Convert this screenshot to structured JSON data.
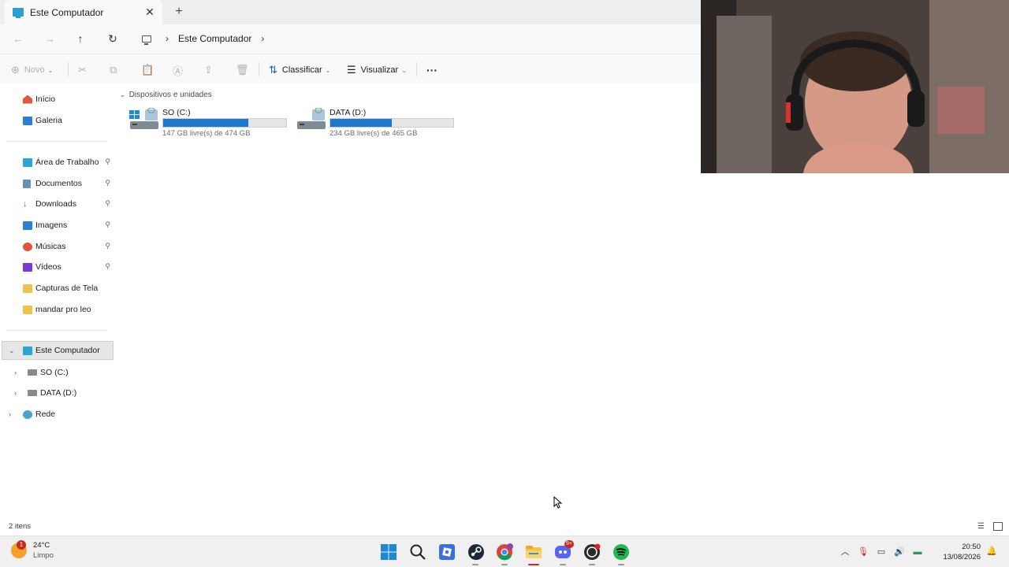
{
  "window": {
    "tab_title": "Este Computador",
    "tab_close": "✕",
    "new_tab": "+"
  },
  "nav": {
    "back": "←",
    "forward": "→",
    "up": "↑",
    "refresh": "↻",
    "breadcrumb": [
      "Este Computador"
    ],
    "sep": "›"
  },
  "toolbar": {
    "new_label": "Novo",
    "sort_label": "Classificar",
    "view_label": "Visualizar",
    "more": "···"
  },
  "sidebar": {
    "top_items": [
      {
        "label": "Início",
        "icon": "home-icon",
        "color": "#e05a3a"
      },
      {
        "label": "Galeria",
        "icon": "gallery-icon",
        "color": "#2a7fd6"
      }
    ],
    "pinned": [
      {
        "label": "Área de Trabalho",
        "icon": "desktop-icon",
        "color": "#2aa6d6"
      },
      {
        "label": "Documentos",
        "icon": "documents-icon",
        "color": "#6a8fb5"
      },
      {
        "label": "Downloads",
        "icon": "downloads-icon",
        "color": "#2e9a5e"
      },
      {
        "label": "Imagens",
        "icon": "pictures-icon",
        "color": "#2a7fd6"
      },
      {
        "label": "Músicas",
        "icon": "music-icon",
        "color": "#e0533a"
      },
      {
        "label": "Vídeos",
        "icon": "videos-icon",
        "color": "#7a3ad6"
      },
      {
        "label": "Capturas de Tela",
        "icon": "folder-icon",
        "color": "#f0c14b"
      },
      {
        "label": "mandar pro leo",
        "icon": "folder-icon",
        "color": "#f0c14b"
      }
    ],
    "pin_glyph": "📌",
    "tree": [
      {
        "label": "Este Computador",
        "icon": "this-pc-icon",
        "selected": true
      },
      {
        "label": "SO (C:)",
        "icon": "drive-c-icon"
      },
      {
        "label": "DATA (D:)",
        "icon": "drive-d-icon"
      },
      {
        "label": "Rede",
        "icon": "network-icon"
      }
    ]
  },
  "main": {
    "group_header": "Dispositivos e unidades",
    "drives": [
      {
        "label": "SO (C:)",
        "free": "147 GB livre(s) de 474 GB",
        "used_fraction": 0.69
      },
      {
        "label": "DATA (D:)",
        "free": "234 GB livre(s) de 465 GB",
        "used_fraction": 0.5
      }
    ]
  },
  "status": {
    "item_count": "2 itens"
  },
  "taskbar": {
    "weather_temp": "24°C",
    "weather_cond": "Limpo",
    "weather_badge": "1",
    "apps": [
      "windows-start-icon",
      "search-icon",
      "roblox-icon",
      "steam-icon",
      "chrome-icon",
      "file-explorer-icon",
      "discord-icon",
      "obs-icon",
      "spotify-icon"
    ],
    "discord_badge": "9+",
    "time": "20:50",
    "date": "13/08/2026"
  }
}
